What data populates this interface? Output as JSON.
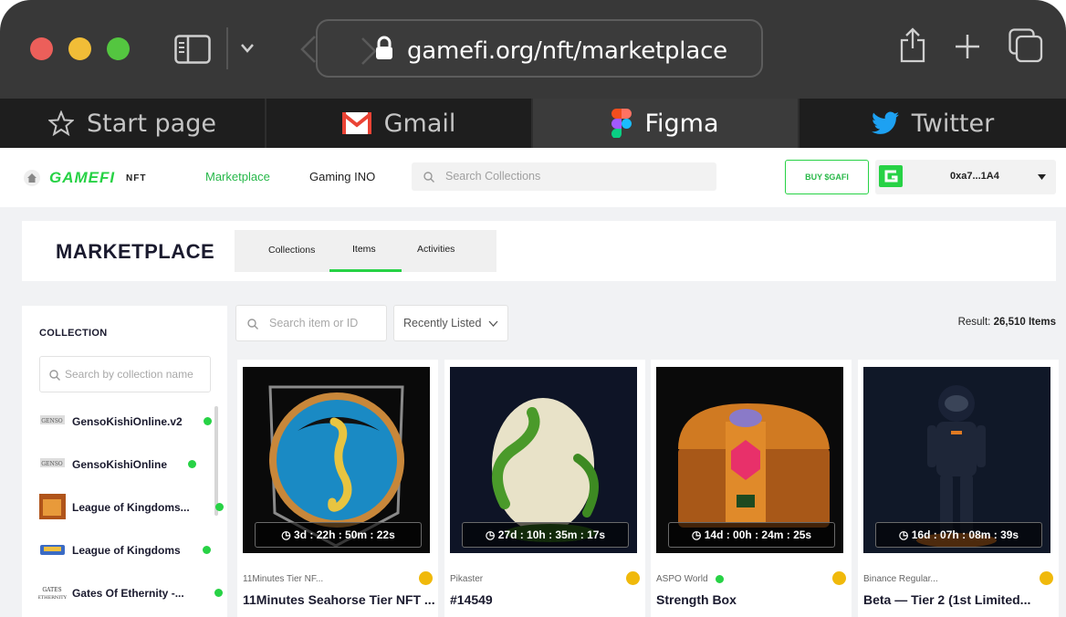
{
  "browser": {
    "url": "gamefi.org/nft/marketplace",
    "tabs": [
      {
        "label": "Start page",
        "icon": "star-icon"
      },
      {
        "label": "Gmail",
        "icon": "gmail-icon"
      },
      {
        "label": "Figma",
        "icon": "figma-icon"
      },
      {
        "label": "Twitter",
        "icon": "twitter-icon"
      }
    ],
    "active_tab": 2
  },
  "topnav": {
    "logo": "GAMEFI",
    "logo_suffix": "NFT",
    "links": [
      "Marketplace",
      "Gaming INO"
    ],
    "search_placeholder": "Search Collections",
    "buy_label": "BUY $GAFI",
    "wallet_address": "0xa7...1A4",
    "accent": "#27d245"
  },
  "marketplace": {
    "title": "MARKETPLACE",
    "tabs": [
      "Collections",
      "Items",
      "Activities"
    ],
    "active_tab": "Items"
  },
  "sidebar": {
    "title": "COLLECTION",
    "search_placeholder": "Search by collection name",
    "collections": [
      {
        "name": "GensoKishiOnline.v2",
        "verified": true
      },
      {
        "name": "GensoKishiOnline",
        "verified": true
      },
      {
        "name": "League of Kingdoms...",
        "verified": true
      },
      {
        "name": "League of Kingdoms",
        "verified": true
      },
      {
        "name": "Gates Of Ethernity -...",
        "verified": true
      }
    ]
  },
  "filters": {
    "item_search_placeholder": "Search item or ID",
    "sort": "Recently Listed",
    "result_label": "Result:",
    "result_count": "26,510 Items"
  },
  "cards": [
    {
      "collection": "11Minutes Tier NF...",
      "name": "11Minutes Seahorse Tier NFT ...",
      "timer": "3d : 22h : 50m : 22s",
      "verified": false
    },
    {
      "collection": "Pikaster",
      "name": "#14549",
      "timer": "27d : 10h : 35m : 17s",
      "verified": false
    },
    {
      "collection": "ASPO World",
      "name": "Strength Box",
      "timer": "14d : 00h : 24m : 25s",
      "verified": true
    },
    {
      "collection": "Binance Regular...",
      "name": "Beta — Tier 2 (1st Limited...",
      "timer": "16d : 07h : 08m : 39s",
      "verified": false
    }
  ]
}
